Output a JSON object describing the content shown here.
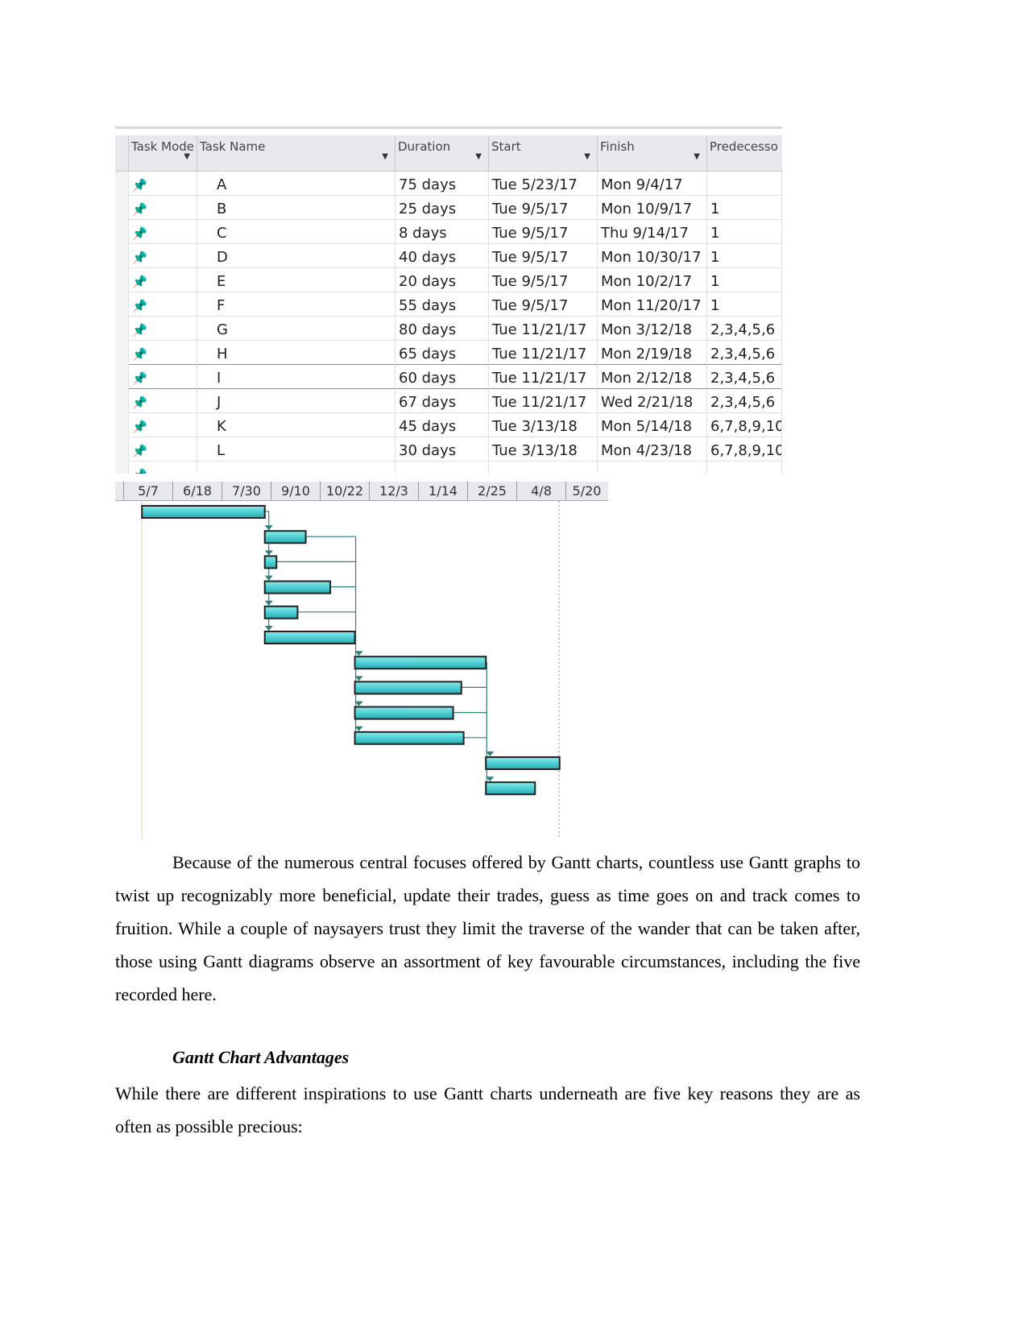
{
  "table": {
    "columns": [
      {
        "label": "Task Mode",
        "has_dropdown": true
      },
      {
        "label": "Task Name",
        "has_dropdown": true
      },
      {
        "label": "Duration",
        "has_dropdown": true
      },
      {
        "label": "Start",
        "has_dropdown": true
      },
      {
        "label": "Finish",
        "has_dropdown": true
      },
      {
        "label": "Predecesso",
        "has_dropdown": false
      }
    ],
    "mode_icon": "pushpin-icon",
    "rows": [
      {
        "name": "A",
        "duration": "75 days",
        "start": "Tue 5/23/17",
        "finish": "Mon 9/4/17",
        "pred": ""
      },
      {
        "name": "B",
        "duration": "25 days",
        "start": "Tue 9/5/17",
        "finish": "Mon 10/9/17",
        "pred": "1"
      },
      {
        "name": "C",
        "duration": "8 days",
        "start": "Tue 9/5/17",
        "finish": "Thu 9/14/17",
        "pred": "1"
      },
      {
        "name": "D",
        "duration": "40 days",
        "start": "Tue 9/5/17",
        "finish": "Mon 10/30/17",
        "pred": "1"
      },
      {
        "name": "E",
        "duration": "20 days",
        "start": "Tue 9/5/17",
        "finish": "Mon 10/2/17",
        "pred": "1"
      },
      {
        "name": "F",
        "duration": "55 days",
        "start": "Tue 9/5/17",
        "finish": "Mon 11/20/17",
        "pred": "1"
      },
      {
        "name": "G",
        "duration": "80 days",
        "start": "Tue 11/21/17",
        "finish": "Mon 3/12/18",
        "pred": "2,3,4,5,6"
      },
      {
        "name": "H",
        "duration": "65 days",
        "start": "Tue 11/21/17",
        "finish": "Mon 2/19/18",
        "pred": "2,3,4,5,6"
      },
      {
        "name": "I",
        "duration": "60 days",
        "start": "Tue 11/21/17",
        "finish": "Mon 2/12/18",
        "pred": "2,3,4,5,6"
      },
      {
        "name": "J",
        "duration": "67 days",
        "start": "Tue 11/21/17",
        "finish": "Wed 2/21/18",
        "pred": "2,3,4,5,6"
      },
      {
        "name": "K",
        "duration": "45 days",
        "start": "Tue 3/13/18",
        "finish": "Mon 5/14/18",
        "pred": "6,7,8,9,10"
      },
      {
        "name": "L",
        "duration": "30 days",
        "start": "Tue 3/13/18",
        "finish": "Mon 4/23/18",
        "pred": "6,7,8,9,10"
      }
    ]
  },
  "chart_data": {
    "type": "gantt",
    "timescale_ticks": [
      "5/7",
      "6/18",
      "7/30",
      "9/10",
      "10/22",
      "12/3",
      "1/14",
      "2/25",
      "4/8",
      "5/20"
    ],
    "bar_color": "#4fd0d4",
    "link_color": "#2f7f7a"
  },
  "body": {
    "paragraph1": "Because of the numerous central focuses offered by Gantt charts, countless use Gantt graphs to twist up recognizably more beneficial, update their trades, guess as time goes on and track comes to fruition. While a couple of naysayers trust they limit the traverse of the wander that can be taken after, those using Gantt diagrams observe an assortment of key favourable circumstances, including the five recorded here.",
    "heading": "Gantt Chart Advantages",
    "paragraph2": "While there are different inspirations to use Gantt charts underneath are five key reasons they are as often as possible precious:"
  }
}
